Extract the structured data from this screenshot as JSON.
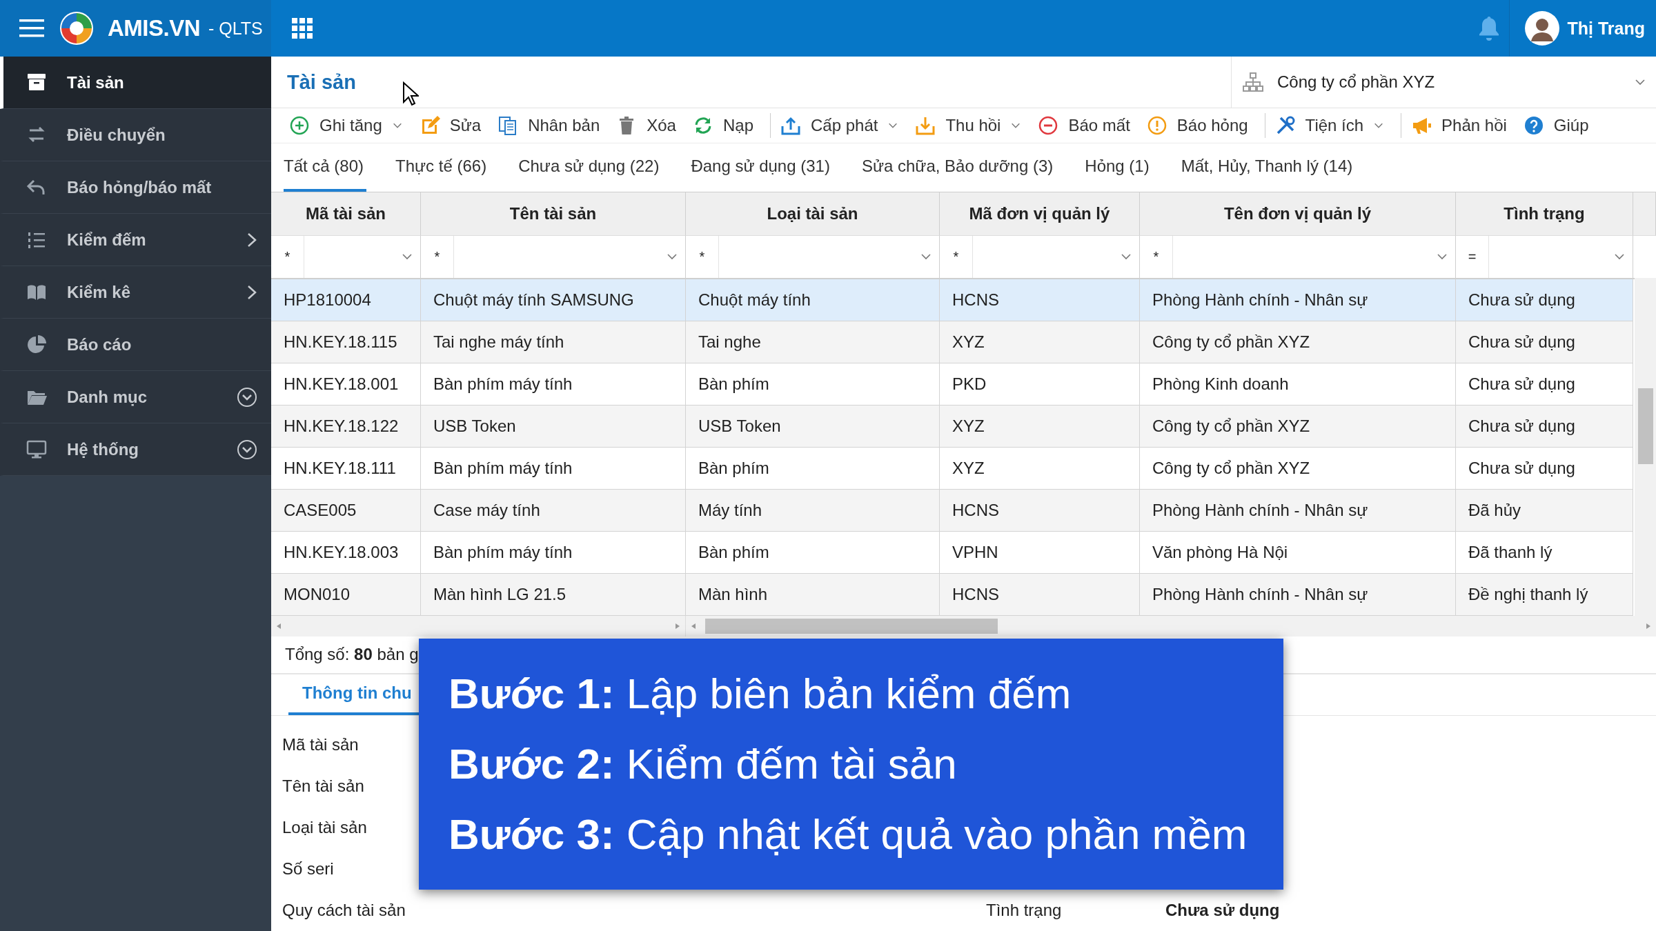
{
  "topbar": {
    "brand": "AMIS.VN",
    "product": "- QLTS",
    "user": "Thị Trang"
  },
  "sidebar": {
    "items": [
      {
        "label": "Tài sản",
        "selected": true,
        "submenu": false,
        "expandable": false
      },
      {
        "label": "Điều chuyển",
        "selected": false,
        "submenu": false,
        "expandable": false
      },
      {
        "label": "Báo hỏng/báo mất",
        "selected": false,
        "submenu": false,
        "expandable": false
      },
      {
        "label": "Kiểm đếm",
        "selected": false,
        "submenu": true,
        "expandable": false
      },
      {
        "label": "Kiểm kê",
        "selected": false,
        "submenu": true,
        "expandable": false
      },
      {
        "label": "Báo cáo",
        "selected": false,
        "submenu": false,
        "expandable": false
      },
      {
        "label": "Danh mục",
        "selected": false,
        "submenu": false,
        "expandable": true
      },
      {
        "label": "Hệ thống",
        "selected": false,
        "submenu": false,
        "expandable": true
      }
    ]
  },
  "header": {
    "title": "Tài sản",
    "company": "Công ty cổ phần XYZ"
  },
  "toolbar": [
    {
      "label": "Ghi tăng",
      "dropdown": true,
      "separator": false
    },
    {
      "label": "Sửa",
      "dropdown": false,
      "separator": false
    },
    {
      "label": "Nhân bản",
      "dropdown": false,
      "separator": false
    },
    {
      "label": "Xóa",
      "dropdown": false,
      "separator": false
    },
    {
      "label": "Nạp",
      "dropdown": false,
      "separator": true
    },
    {
      "label": "Cấp phát",
      "dropdown": true,
      "separator": false
    },
    {
      "label": "Thu hồi",
      "dropdown": true,
      "separator": false
    },
    {
      "label": "Báo mất",
      "dropdown": false,
      "separator": false
    },
    {
      "label": "Báo hỏng",
      "dropdown": false,
      "separator": true
    },
    {
      "label": "Tiện ích",
      "dropdown": true,
      "separator": true
    },
    {
      "label": "Phản hồi",
      "dropdown": false,
      "separator": false
    },
    {
      "label": "Giúp",
      "dropdown": false,
      "separator": false
    }
  ],
  "tabs": [
    {
      "label": "Tất cả (80)",
      "selected": true
    },
    {
      "label": "Thực tế (66)",
      "selected": false
    },
    {
      "label": "Chưa sử dụng (22)",
      "selected": false
    },
    {
      "label": "Đang sử dụng (31)",
      "selected": false
    },
    {
      "label": "Sửa chữa, Bảo dưỡng (3)",
      "selected": false
    },
    {
      "label": "Hỏng (1)",
      "selected": false
    },
    {
      "label": "Mất, Hủy, Thanh lý (14)",
      "selected": false
    }
  ],
  "table": {
    "columns": [
      {
        "title": "Mã tài sản",
        "filter_operator": "*"
      },
      {
        "title": "Tên tài sản",
        "filter_operator": "*"
      },
      {
        "title": "Loại tài sản",
        "filter_operator": "*"
      },
      {
        "title": "Mã đơn vị quản lý",
        "filter_operator": "*"
      },
      {
        "title": "Tên đơn vị quản lý",
        "filter_operator": "*"
      },
      {
        "title": "Tình trạng",
        "filter_operator": "="
      }
    ],
    "rows": [
      {
        "selected": true,
        "cells": [
          "HP1810004",
          "Chuột máy tính SAMSUNG",
          "Chuột máy tính",
          "HCNS",
          "Phòng Hành chính - Nhân sự",
          "Chưa sử dụng"
        ]
      },
      {
        "selected": false,
        "cells": [
          "HN.KEY.18.115",
          "Tai nghe máy tính",
          "Tai nghe",
          "XYZ",
          "Công ty cổ phần XYZ",
          "Chưa sử dụng"
        ]
      },
      {
        "selected": false,
        "cells": [
          "HN.KEY.18.001",
          "Bàn phím máy tính",
          "Bàn phím",
          "PKD",
          "Phòng Kinh doanh",
          "Chưa sử dụng"
        ]
      },
      {
        "selected": false,
        "cells": [
          "HN.KEY.18.122",
          "USB Token",
          "USB Token",
          "XYZ",
          "Công ty cổ phần XYZ",
          "Chưa sử dụng"
        ]
      },
      {
        "selected": false,
        "cells": [
          "HN.KEY.18.111",
          "Bàn phím máy tính",
          "Bàn phím",
          "XYZ",
          "Công ty cổ phần XYZ",
          "Chưa sử dụng"
        ]
      },
      {
        "selected": false,
        "cells": [
          "CASE005",
          "Case máy tính",
          "Máy tính",
          "HCNS",
          "Phòng Hành chính - Nhân sự",
          "Đã hủy"
        ]
      },
      {
        "selected": false,
        "cells": [
          "HN.KEY.18.003",
          "Bàn phím máy tính",
          "Bàn phím",
          "VPHN",
          "Văn phòng Hà Nội",
          "Đã thanh lý"
        ]
      },
      {
        "selected": false,
        "cells": [
          "MON010",
          "Màn hình LG 21.5",
          "Màn hình",
          "HCNS",
          "Phòng Hành chính - Nhân sự",
          "Đề nghị thanh lý"
        ]
      }
    ],
    "total": "Tổng số: **80** bản g"
  },
  "detail": {
    "tab": "Thông tin chu",
    "fields": [
      "Mã tài sản",
      "Tên tài sản",
      "Loại tài sản",
      "Số seri",
      "Quy cách tài sản"
    ],
    "status_label": "Tình trạng",
    "status_value": "Chưa sử dụng"
  },
  "overlay": {
    "steps": [
      "**Bước 1:** Lập biên bản kiểm đếm",
      "**Bước 2:** Kiểm đếm tài sản",
      "**Bước 3:** Cập nhật kết quả vào phần mềm"
    ]
  }
}
